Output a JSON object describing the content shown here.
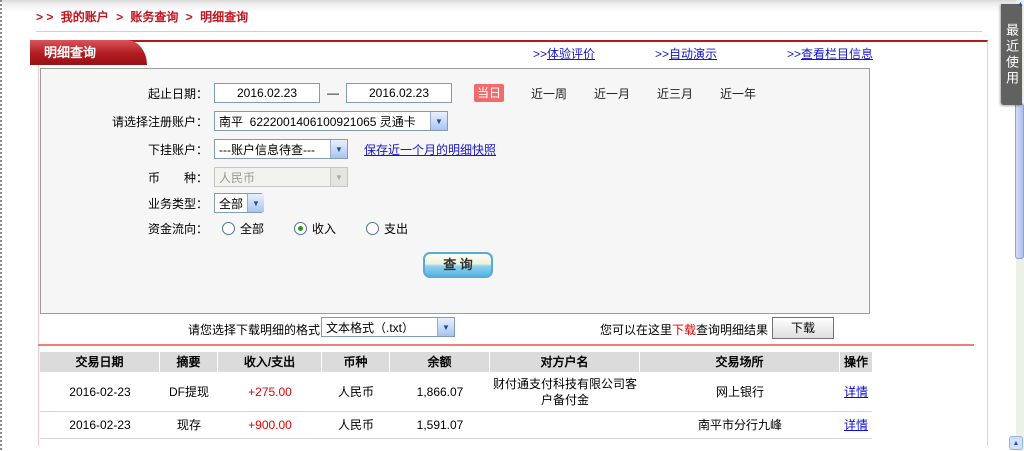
{
  "colors": {
    "brand_red": "#b01b20",
    "breadcrumb_red": "#c2151f",
    "today_button_red": "#f26b6b",
    "amount_red": "#e60000",
    "link_blue": "#1515cc",
    "table_header_gray": "#dbdbdb"
  },
  "icons": {
    "chevron_down": "▼",
    "arrow_up": "▲"
  },
  "breadcrumb": {
    "prefix": "> >",
    "separator": ">",
    "items": [
      "我的账户",
      "账务查询",
      "明细查询"
    ]
  },
  "tab_label": "明细查询",
  "top_links": {
    "prefix": ">>",
    "items": [
      "体验评价",
      "自动演示",
      "查看栏目信息"
    ]
  },
  "form": {
    "date": {
      "label": "起止日期：",
      "start": "2016.02.23",
      "separator": "—",
      "end": "2016.02.23",
      "today": "当日",
      "quick": [
        "近一周",
        "近一月",
        "近三月",
        "近一年"
      ]
    },
    "account": {
      "label": "请选择注册账户：",
      "value": "南平  6222001406100921065 灵通卡"
    },
    "sub_account": {
      "label": "下挂账户：",
      "value": "---账户信息待查---",
      "snapshot_link": "保存近一个月的明细快照"
    },
    "currency": {
      "label": "币　　种：",
      "value": "人民币",
      "disabled": true
    },
    "biz_type": {
      "label": "业务类型：",
      "value": "全部"
    },
    "flow": {
      "label": "资金流向：",
      "options": [
        "全部",
        "收入",
        "支出"
      ],
      "selected_index": 1
    },
    "query_button": "查 询"
  },
  "download": {
    "format_label": "请您选择下载明细的格式",
    "format_value": "文本格式（.txt）",
    "hint_prefix": "您可以在这里",
    "hint_link": "下载",
    "hint_suffix": "查询明细结果",
    "button": "下载"
  },
  "table": {
    "headers": [
      "交易日期",
      "摘要",
      "收入/支出",
      "币种",
      "余额",
      "对方户名",
      "交易场所",
      "操作"
    ],
    "rows": [
      {
        "date": "2016-02-23",
        "summary": "DF提现",
        "amount": "+275.00",
        "currency": "人民币",
        "balance": "1,866.07",
        "counterparty": "财付通支付科技有限公司客户备付金",
        "channel": "网上银行",
        "action": "详情"
      },
      {
        "date": "2016-02-23",
        "summary": "现存",
        "amount": "+900.00",
        "currency": "人民币",
        "balance": "1,591.07",
        "counterparty": "",
        "channel": "南平市分行九峰",
        "action": "详情"
      }
    ]
  },
  "side": {
    "recent_tab": "最近使用"
  }
}
